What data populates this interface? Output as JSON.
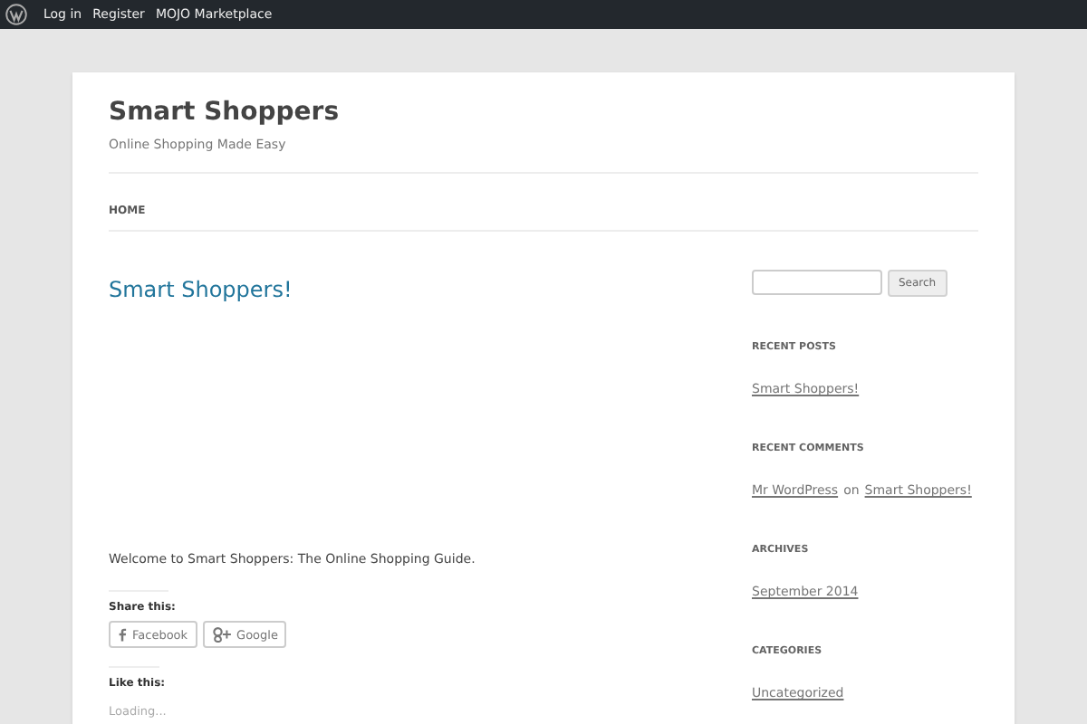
{
  "admin_bar": {
    "items": [
      "Log in",
      "Register",
      "MOJO Marketplace"
    ]
  },
  "site": {
    "title": "Smart Shoppers",
    "tagline": "Online Shopping Made Easy"
  },
  "menu": [
    {
      "label": "HOME",
      "selected": true
    }
  ],
  "post": {
    "title": "Smart Shoppers!",
    "body": "Welcome to Smart Shoppers: The Online Shopping Guide.",
    "share_heading": "Share this:",
    "share_buttons": [
      {
        "kind": "facebook",
        "label": "Facebook"
      },
      {
        "kind": "google",
        "label": "Google"
      }
    ],
    "like_heading": "Like this:",
    "like_status": "Loading..."
  },
  "sidebar": {
    "search": {
      "button": "Search"
    },
    "widgets": [
      {
        "title": "RECENT POSTS",
        "kind": "links",
        "links": [
          "Smart Shoppers!"
        ]
      },
      {
        "title": "RECENT COMMENTS",
        "kind": "comment",
        "author": "Mr WordPress",
        "joiner": "on",
        "post": "Smart Shoppers!"
      },
      {
        "title": "ARCHIVES",
        "kind": "links",
        "links": [
          "September 2014"
        ]
      },
      {
        "title": "CATEGORIES",
        "kind": "links",
        "links": [
          "Uncategorized"
        ]
      }
    ]
  }
}
